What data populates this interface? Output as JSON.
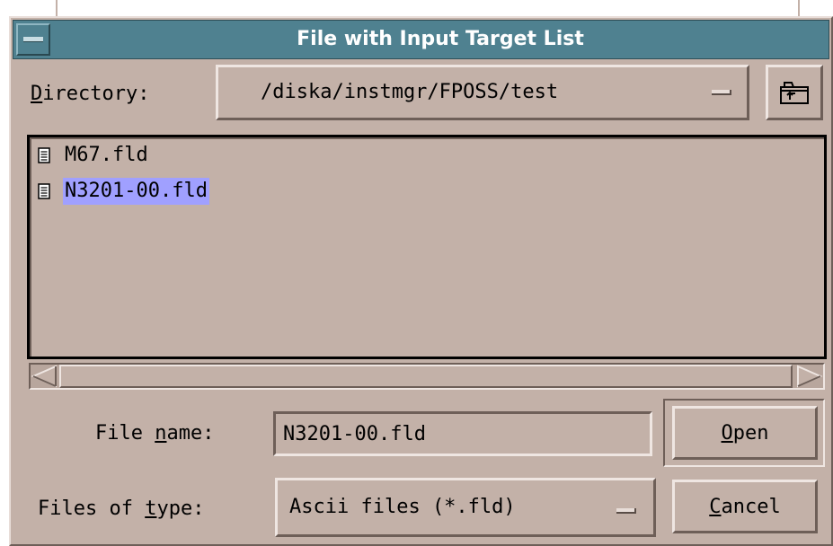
{
  "window": {
    "title": "File with Input Target List"
  },
  "directory": {
    "label_prefix": "",
    "label_mnemonic": "D",
    "label_rest": "irectory:",
    "value": "/diska/instmgr/FPOSS/test"
  },
  "files": [
    {
      "name": "M67.fld",
      "selected": false
    },
    {
      "name": "N3201-00.fld",
      "selected": true
    }
  ],
  "file_name": {
    "label_prefix": "File ",
    "label_mnemonic": "n",
    "label_rest": "ame:",
    "value": "N3201-00.fld"
  },
  "file_type": {
    "label_prefix": "Files of ",
    "label_mnemonic": "t",
    "label_rest": "ype:",
    "value": "Ascii files (*.fld)"
  },
  "buttons": {
    "open_mnemonic": "O",
    "open_rest": "pen",
    "cancel_mnemonic": "C",
    "cancel_rest": "ancel"
  },
  "icons": {
    "window_menu": "window-menu-icon",
    "combo": "combo-indicator-icon",
    "up_folder": "up-folder-icon",
    "file": "file-icon",
    "scroll_left": "arrow-left-icon",
    "scroll_right": "arrow-right-icon"
  },
  "colors": {
    "background": "#c3b1a8",
    "titlebar": "#4f8190",
    "selection": "#a0a0ff"
  }
}
